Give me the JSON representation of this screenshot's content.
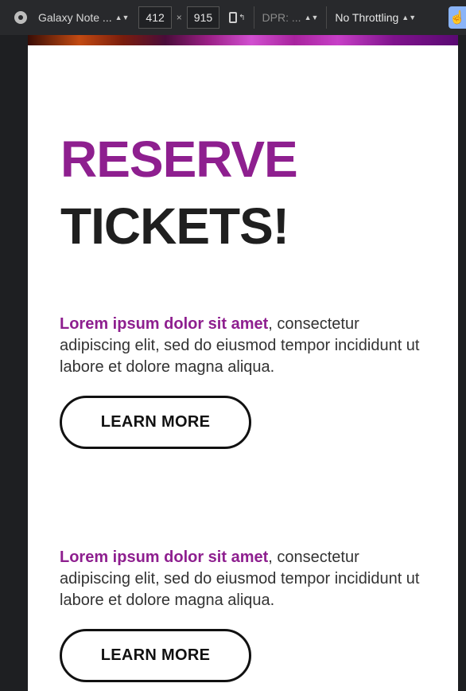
{
  "toolbar": {
    "device": "Galaxy Note ...",
    "width": "412",
    "height": "915",
    "dpr": "DPR: ...",
    "throttling": "No Throttling",
    "times_symbol": "×"
  },
  "page": {
    "headline_line1": "RESERVE",
    "headline_line2": "TICKETS!",
    "sections": [
      {
        "lead": "Lorem ipsum dolor sit amet",
        "body": ", consectetur adipiscing elit, sed do eiusmod tempor incididunt ut labore et dolore magna aliqua.",
        "button": "LEARN MORE"
      },
      {
        "lead": "Lorem ipsum dolor sit amet",
        "body": ", consectetur adipiscing elit, sed do eiusmod tempor incididunt ut labore et dolore magna aliqua.",
        "button": "LEARN MORE"
      }
    ]
  },
  "colors": {
    "accent": "#8e1f8f",
    "text": "#1f1f1f",
    "toolbar_bg": "#28292c"
  },
  "icons": [
    "chrome-icon",
    "rotate-icon",
    "touch-icon"
  ]
}
